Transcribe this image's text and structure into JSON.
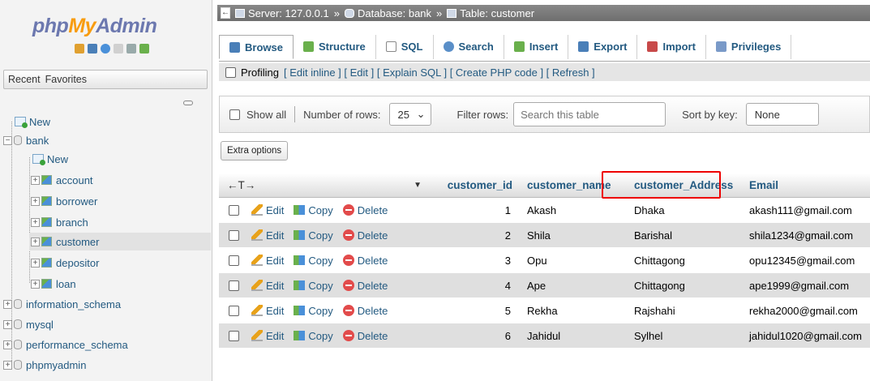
{
  "logo": {
    "php": "php",
    "my": "My",
    "admin": "Admin"
  },
  "nav_tabs": [
    "Recent",
    "Favorites"
  ],
  "tree": [
    {
      "label": "New",
      "type": "new"
    },
    {
      "label": "bank",
      "type": "db"
    },
    {
      "label": "New",
      "type": "new"
    },
    {
      "label": "account",
      "type": "table"
    },
    {
      "label": "borrower",
      "type": "table"
    },
    {
      "label": "branch",
      "type": "table"
    },
    {
      "label": "customer",
      "type": "table",
      "selected": true
    },
    {
      "label": "depositor",
      "type": "table"
    },
    {
      "label": "loan",
      "type": "table"
    },
    {
      "label": "information_schema",
      "type": "db"
    },
    {
      "label": "mysql",
      "type": "db"
    },
    {
      "label": "performance_schema",
      "type": "db"
    },
    {
      "label": "phpmyadmin",
      "type": "db"
    }
  ],
  "breadcrumb": {
    "server": "Server: 127.0.0.1",
    "database": "Database: bank",
    "table": "Table: customer",
    "sep": "»"
  },
  "tabs": [
    {
      "label": "Browse",
      "icon": "browse-icon",
      "color": "#4a7fb8"
    },
    {
      "label": "Structure",
      "icon": "structure-icon",
      "color": "#6ab04c"
    },
    {
      "label": "SQL",
      "icon": "sql-icon",
      "color": "#8a8a8a"
    },
    {
      "label": "Search",
      "icon": "search-icon",
      "color": "#5a8fc8"
    },
    {
      "label": "Insert",
      "icon": "insert-icon",
      "color": "#6ab04c"
    },
    {
      "label": "Export",
      "icon": "export-icon",
      "color": "#4a7fb8"
    },
    {
      "label": "Import",
      "icon": "import-icon",
      "color": "#c84a4a"
    },
    {
      "label": "Privileges",
      "icon": "privileges-icon",
      "color": "#7a9ac8"
    }
  ],
  "profiling": {
    "label": "Profiling",
    "links": "[ Edit inline ] [ Edit ] [ Explain SQL ] [ Create PHP code ] [ Refresh ]"
  },
  "navbar": {
    "show_all": "Show all",
    "rows_label": "Number of rows:",
    "rows_value": "25",
    "filter_label": "Filter rows:",
    "filter_placeholder": "Search this table",
    "sort_label": "Sort by key:",
    "sort_value": "None"
  },
  "extra_options": "Extra options",
  "columns": {
    "arrows": "←T→",
    "customer_id": "customer_id",
    "customer_name": "customer_name",
    "customer_address": "customer_Address",
    "email": "Email"
  },
  "actions": {
    "edit": "Edit",
    "copy": "Copy",
    "delete": "Delete"
  },
  "rows": [
    {
      "id": "1",
      "name": "Akash",
      "address": "Dhaka",
      "email": "akash111@gmail.com"
    },
    {
      "id": "2",
      "name": "Shila",
      "address": "Barishal",
      "email": "shila1234@gmail.com"
    },
    {
      "id": "3",
      "name": "Opu",
      "address": "Chittagong",
      "email": "opu12345@gmail.com"
    },
    {
      "id": "4",
      "name": "Ape",
      "address": "Chittagong",
      "email": "ape1999@gmail.com"
    },
    {
      "id": "5",
      "name": "Rekha",
      "address": "Rajshahi",
      "email": "rekha2000@gmail.com"
    },
    {
      "id": "6",
      "name": "Jahidul",
      "address": "Sylhel",
      "email": "jahidul1020@gmail.com"
    }
  ]
}
